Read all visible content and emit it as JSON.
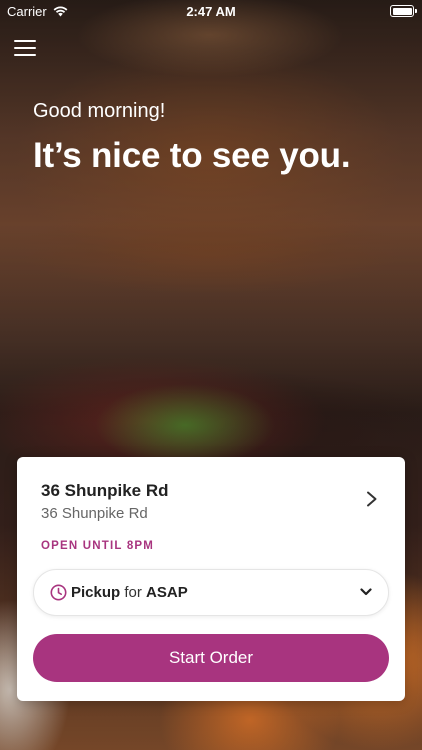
{
  "status_bar": {
    "carrier": "Carrier",
    "time": "2:47 AM"
  },
  "header": {
    "greeting": "Good morning!",
    "headline": "It’s nice to see you."
  },
  "location": {
    "name": "36 Shunpike Rd",
    "address": "36 Shunpike Rd",
    "hours": "OPEN UNTIL 8PM"
  },
  "order": {
    "mode": "Pickup",
    "connector": "for",
    "time": "ASAP",
    "button_label": "Start Order"
  },
  "colors": {
    "accent": "#a8347f"
  },
  "icons": {
    "menu": "hamburger-menu-icon",
    "wifi": "wifi-icon",
    "battery": "battery-icon",
    "chevron_right": "chevron-right-icon",
    "chevron_down": "chevron-down-icon",
    "clock": "clock-icon"
  }
}
